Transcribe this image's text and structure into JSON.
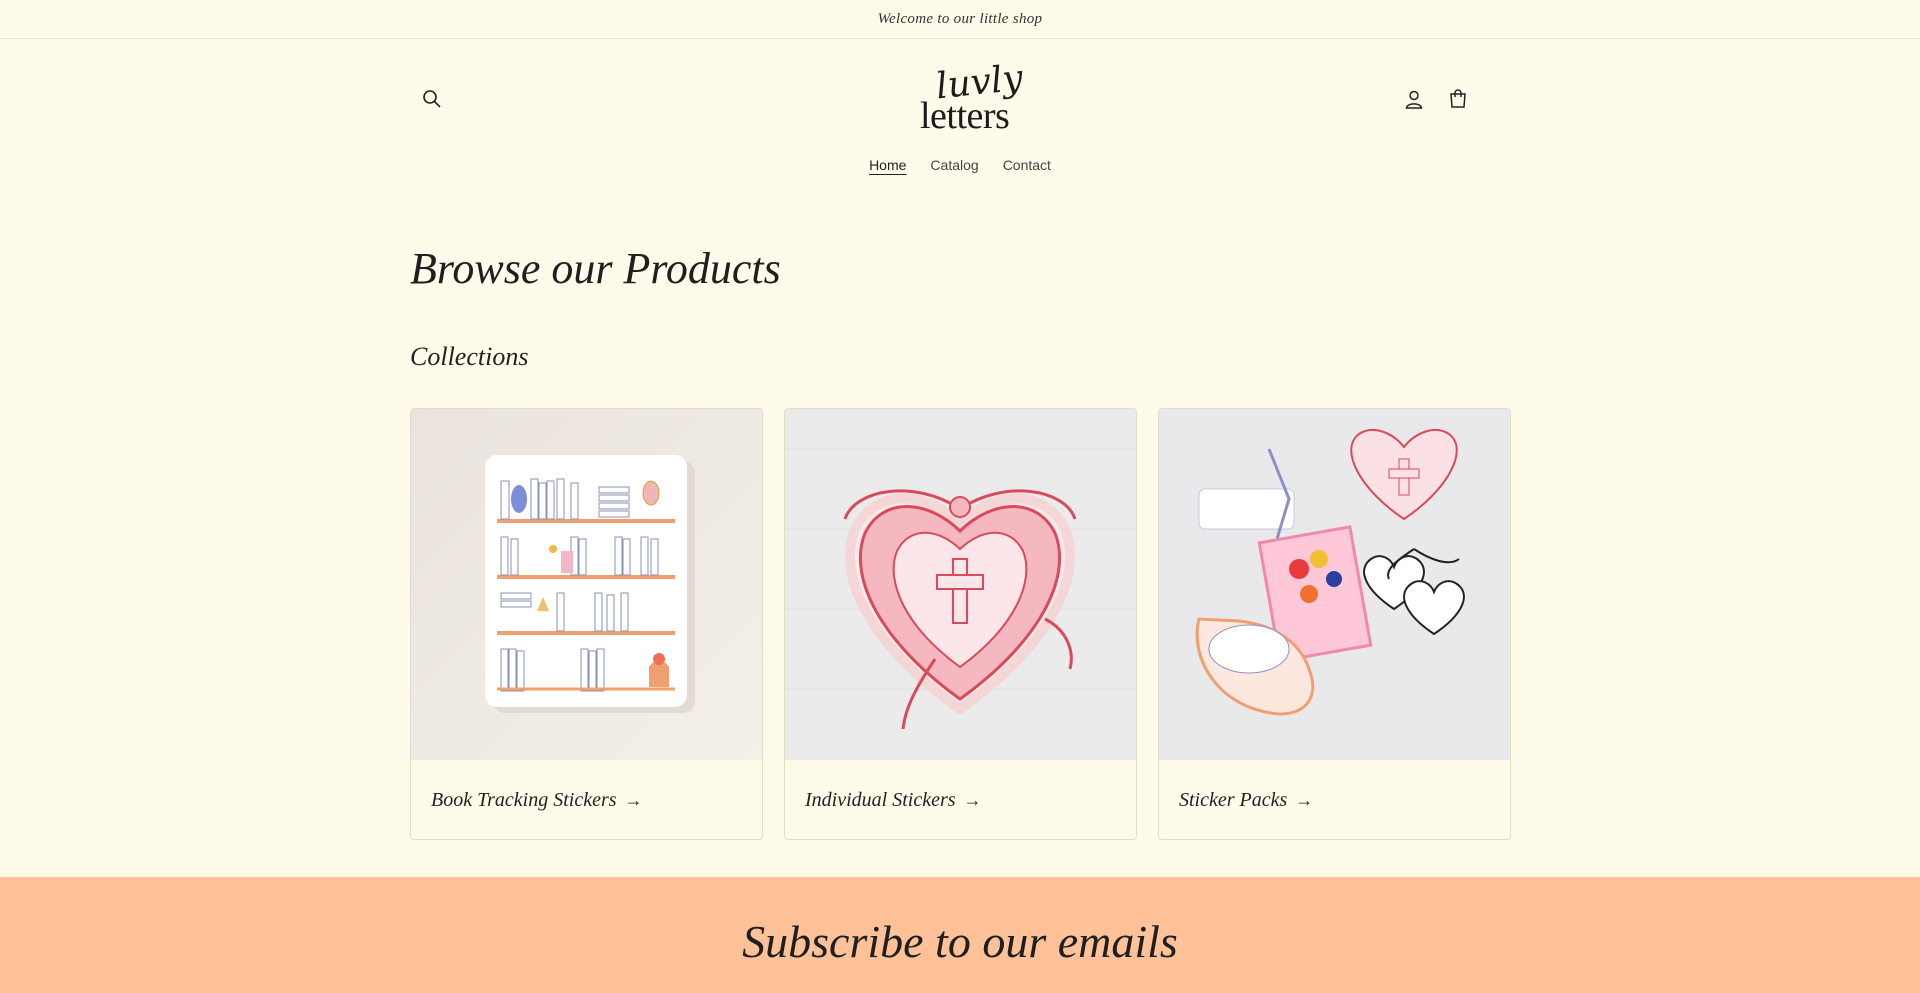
{
  "announcement": {
    "text": "Welcome to our little shop"
  },
  "header": {
    "logo": {
      "script": "luvly",
      "main": "letters"
    },
    "icons": {
      "search": "search-icon",
      "account": "account-icon",
      "cart": "cart-icon"
    }
  },
  "nav": {
    "items": [
      {
        "label": "Home",
        "active": true
      },
      {
        "label": "Catalog",
        "active": false
      },
      {
        "label": "Contact",
        "active": false
      }
    ]
  },
  "main": {
    "title": "Browse our Products",
    "collections_heading": "Collections",
    "collections": [
      {
        "label": "Book Tracking Stickers",
        "image": "bookshelf-sticker-sheet"
      },
      {
        "label": "Individual Stickers",
        "image": "red-heart-cross-sticker"
      },
      {
        "label": "Sticker Packs",
        "image": "assorted-sticker-pack"
      }
    ],
    "arrow": "→"
  },
  "subscribe": {
    "title": "Subscribe to our emails"
  },
  "colors": {
    "background": "#fffbeb",
    "subscribe_bg": "#ffc298",
    "accent_red": "#d94a5a",
    "border": "#e3dcc6"
  }
}
